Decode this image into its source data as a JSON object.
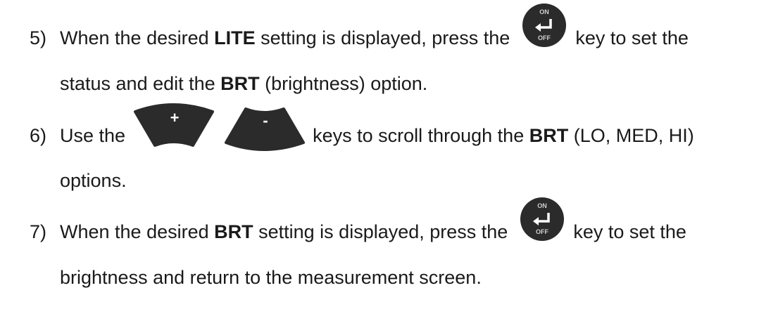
{
  "steps": [
    {
      "number": "5)",
      "before": "When the desired ",
      "bold1": "LITE",
      "middle": " setting is displayed, press the ",
      "after": " key to set the",
      "line2_before": "status and edit the ",
      "line2_bold": "BRT",
      "line2_after": " (brightness) option."
    },
    {
      "number": "6)",
      "before": "Use the ",
      "after": " keys to scroll through the ",
      "bold1": "BRT",
      "tail": " (LO, MED, HI)",
      "line2": "options."
    },
    {
      "number": "7)",
      "before": "When the desired ",
      "bold1": "BRT",
      "middle": " setting is displayed, press the ",
      "after": " key to set the",
      "line2": "brightness and return to the measurement screen."
    }
  ],
  "keys": {
    "enter_on": "ON",
    "enter_off": "OFF",
    "plus": "+",
    "minus": "-"
  },
  "colors": {
    "text": "#1a1a1a",
    "key_body": "#2b2b2b",
    "key_symbol": "#ffffff"
  }
}
